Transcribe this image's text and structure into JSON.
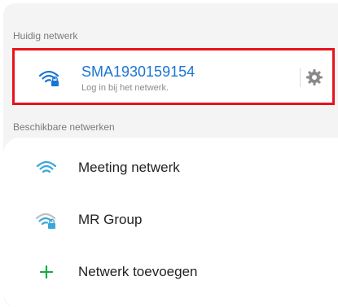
{
  "current_section": {
    "header": "Huidig netwerk",
    "network_name": "SMA1930159154",
    "status": "Log in bij het netwerk.",
    "icon": "wifi-lock-icon",
    "settings_icon": "gear-icon"
  },
  "available_section": {
    "header": "Beschikbare netwerken",
    "items": [
      {
        "label": "Meeting netwerk",
        "icon": "wifi-icon"
      },
      {
        "label": "MR Group",
        "icon": "wifi-lock-icon"
      },
      {
        "label": "Netwerk toevoegen",
        "icon": "plus-icon"
      }
    ]
  },
  "colors": {
    "accent": "#1a76d2",
    "highlight_border": "#e8131b",
    "wifi_connected": "#1a76d2",
    "wifi_available": "#3aa7d8",
    "wifi_weak": "#bfbfbf",
    "plus": "#1aa84e"
  }
}
